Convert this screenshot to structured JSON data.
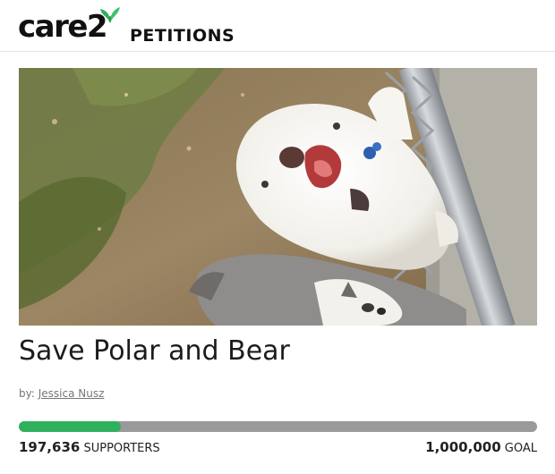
{
  "header": {
    "logo_text": "care2",
    "logo_icon": "butterfly-leaf-icon",
    "section_label": "PETITIONS",
    "brand_color": "#2fb15b"
  },
  "hero": {
    "image_subject": "photo-of-two-husky-puppies"
  },
  "petition": {
    "title": "Save Polar and Bear",
    "by_label": "by:",
    "author": "Jessica Nusz",
    "progress_fraction": 0.197636,
    "supporters_count": "197,636",
    "supporters_label": "SUPPORTERS",
    "goal_count": "1,000,000",
    "goal_label": "GOAL"
  },
  "colors": {
    "progress_fill": "#2fb15b",
    "progress_track": "#9a9a9a"
  }
}
